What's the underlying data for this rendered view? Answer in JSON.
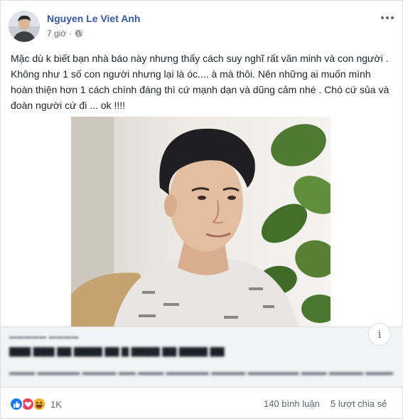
{
  "post": {
    "author": "Nguyen Le Viet Anh",
    "time": "7 giờ",
    "privacy_icon": "globe-icon",
    "text": "Mặc dù k biết bạn nhà báo này nhưng thấy cách suy nghĩ rất văn minh và con người . Không như 1 số con người nhưng lại là óc.... à mà thôi. Nên những ai muốn mình hoàn thiện hơn 1 cách chính đáng thì cứ mạnh dạn và dũng cảm nhé . Chó cứ sủa và đoàn người cứ đi ... ok !!!!"
  },
  "link_preview": {
    "info_icon_glyph": "i"
  },
  "footer": {
    "reaction_icons": [
      "like-icon",
      "love-icon",
      "haha-icon"
    ],
    "reaction_count": "1K",
    "comments": "140 bình luận",
    "shares": "5 lượt chia sẻ"
  },
  "colors": {
    "author_link": "#385898",
    "like": "#1877f2",
    "love": "#f33e58",
    "haha": "#f7b125",
    "preview_bg": "#f2f3f5"
  }
}
